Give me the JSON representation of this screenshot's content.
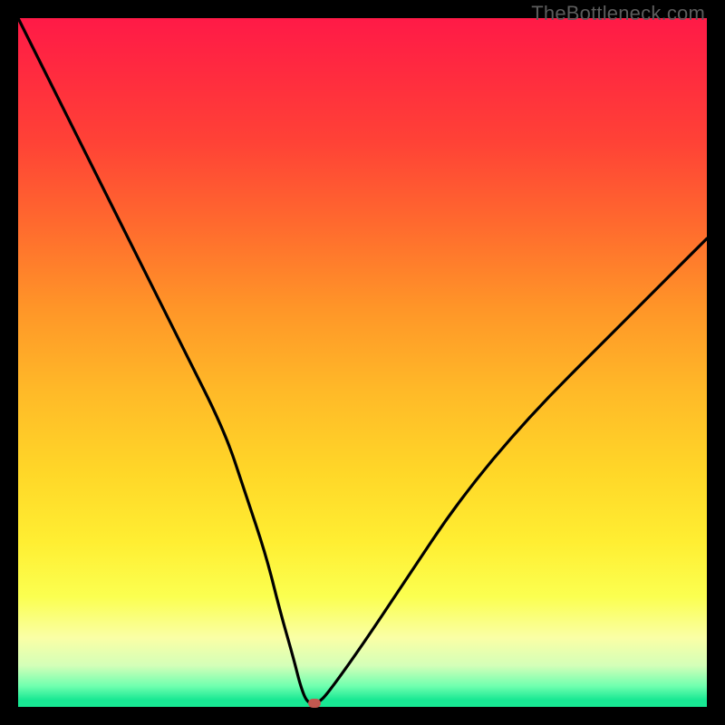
{
  "attribution": "TheBottleneck.com",
  "colors": {
    "curve": "#000000",
    "marker": "#c1584f"
  },
  "chart_data": {
    "type": "line",
    "title": "",
    "xlabel": "",
    "ylabel": "",
    "xlim": [
      0,
      100
    ],
    "ylim": [
      0,
      100
    ],
    "grid": false,
    "legend": false,
    "series": [
      {
        "name": "bottleneck-curve",
        "x": [
          0,
          6,
          12,
          18,
          24,
          30,
          33,
          36,
          38,
          40,
          41,
          42,
          43.5,
          45,
          50,
          56,
          64,
          74,
          86,
          100
        ],
        "values": [
          100,
          88,
          76,
          64,
          52,
          40,
          31,
          22,
          14,
          7,
          3,
          0.5,
          0.5,
          2,
          9,
          18,
          30,
          42,
          54,
          68
        ]
      }
    ],
    "marker": {
      "x": 43,
      "y": 0.5
    }
  }
}
